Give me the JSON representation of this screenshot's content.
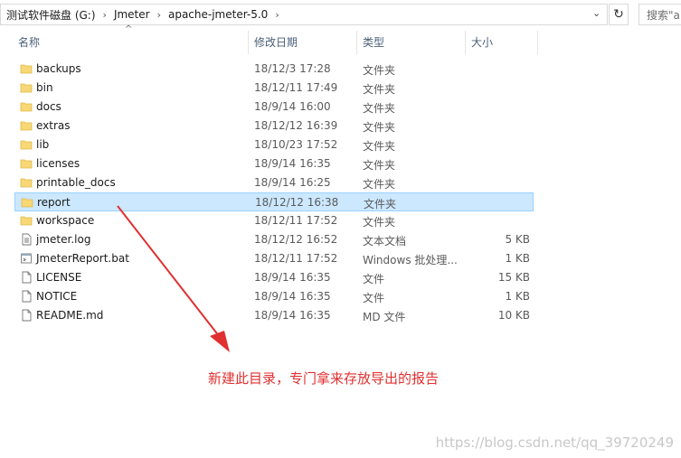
{
  "address": {
    "crumbs": [
      "测试软件磁盘 (G:)",
      "Jmeter",
      "apache-jmeter-5.0"
    ],
    "search_placeholder": "搜索\"a"
  },
  "columns": {
    "name": "名称",
    "date": "修改日期",
    "type": "类型",
    "size": "大小"
  },
  "files": [
    {
      "name": "backups",
      "date": "18/12/3 17:28",
      "type": "文件夹",
      "size": "",
      "icon": "folder-icon"
    },
    {
      "name": "bin",
      "date": "18/12/11 17:49",
      "type": "文件夹",
      "size": "",
      "icon": "folder-icon"
    },
    {
      "name": "docs",
      "date": "18/9/14 16:00",
      "type": "文件夹",
      "size": "",
      "icon": "folder-icon"
    },
    {
      "name": "extras",
      "date": "18/12/12 16:39",
      "type": "文件夹",
      "size": "",
      "icon": "folder-icon"
    },
    {
      "name": "lib",
      "date": "18/10/23 17:52",
      "type": "文件夹",
      "size": "",
      "icon": "folder-icon"
    },
    {
      "name": "licenses",
      "date": "18/9/14 16:35",
      "type": "文件夹",
      "size": "",
      "icon": "folder-icon"
    },
    {
      "name": "printable_docs",
      "date": "18/9/14 16:25",
      "type": "文件夹",
      "size": "",
      "icon": "folder-icon"
    },
    {
      "name": "report",
      "date": "18/12/12 16:38",
      "type": "文件夹",
      "size": "",
      "icon": "folder-icon",
      "selected": true
    },
    {
      "name": "workspace",
      "date": "18/12/11 17:52",
      "type": "文件夹",
      "size": "",
      "icon": "folder-icon"
    },
    {
      "name": "jmeter.log",
      "date": "18/12/12 16:52",
      "type": "文本文档",
      "size": "5 KB",
      "icon": "text-file-icon"
    },
    {
      "name": "JmeterReport.bat",
      "date": "18/12/11 17:52",
      "type": "Windows 批处理...",
      "size": "1 KB",
      "icon": "batch-file-icon"
    },
    {
      "name": "LICENSE",
      "date": "18/9/14 16:35",
      "type": "文件",
      "size": "15 KB",
      "icon": "file-icon"
    },
    {
      "name": "NOTICE",
      "date": "18/9/14 16:35",
      "type": "文件",
      "size": "1 KB",
      "icon": "file-icon"
    },
    {
      "name": "README.md",
      "date": "18/9/14 16:35",
      "type": "MD 文件",
      "size": "10 KB",
      "icon": "file-icon"
    }
  ],
  "annotation": "新建此目录，专门拿来存放导出的报告",
  "watermark": "https://blog.csdn.net/qq_39720249",
  "colors": {
    "selected_bg": "#cce8ff",
    "selected_border": "#99d1ff",
    "folder": "#f8d775",
    "annotation": "#e03030"
  }
}
